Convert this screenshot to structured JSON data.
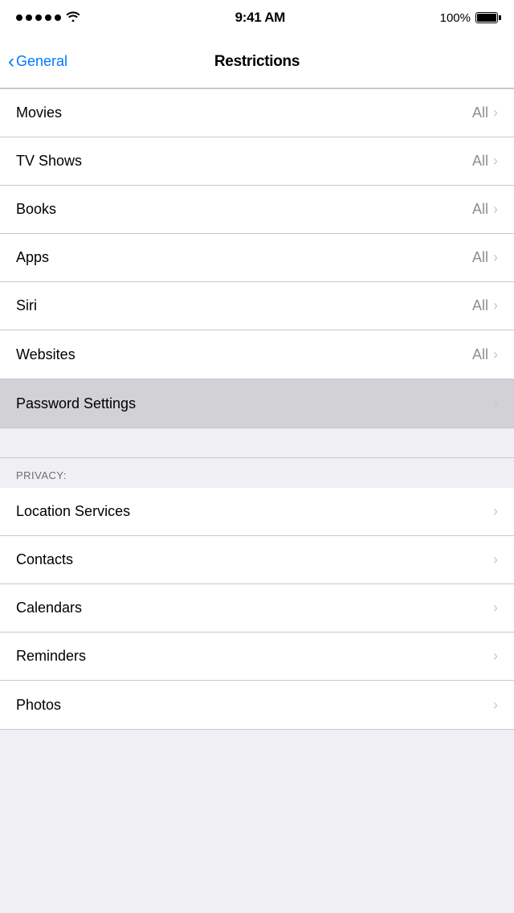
{
  "statusBar": {
    "time": "9:41 AM",
    "battery": "100%"
  },
  "navBar": {
    "backLabel": "General",
    "title": "Restrictions"
  },
  "contentRows": [
    {
      "id": "movies",
      "label": "Movies",
      "value": "All",
      "hasChevron": true
    },
    {
      "id": "tv-shows",
      "label": "TV Shows",
      "value": "All",
      "hasChevron": true
    },
    {
      "id": "books",
      "label": "Books",
      "value": "All",
      "hasChevron": true
    },
    {
      "id": "apps",
      "label": "Apps",
      "value": "All",
      "hasChevron": true
    },
    {
      "id": "siri",
      "label": "Siri",
      "value": "All",
      "hasChevron": true
    },
    {
      "id": "websites",
      "label": "Websites",
      "value": "All",
      "hasChevron": true
    }
  ],
  "passwordRow": {
    "label": "Password Settings",
    "highlighted": true
  },
  "privacySection": {
    "header": "PRIVACY:",
    "rows": [
      {
        "id": "location-services",
        "label": "Location Services",
        "hasChevron": true
      },
      {
        "id": "contacts",
        "label": "Contacts",
        "hasChevron": true
      },
      {
        "id": "calendars",
        "label": "Calendars",
        "hasChevron": true
      },
      {
        "id": "reminders",
        "label": "Reminders",
        "hasChevron": true
      },
      {
        "id": "photos",
        "label": "Photos",
        "hasChevron": true
      }
    ]
  }
}
